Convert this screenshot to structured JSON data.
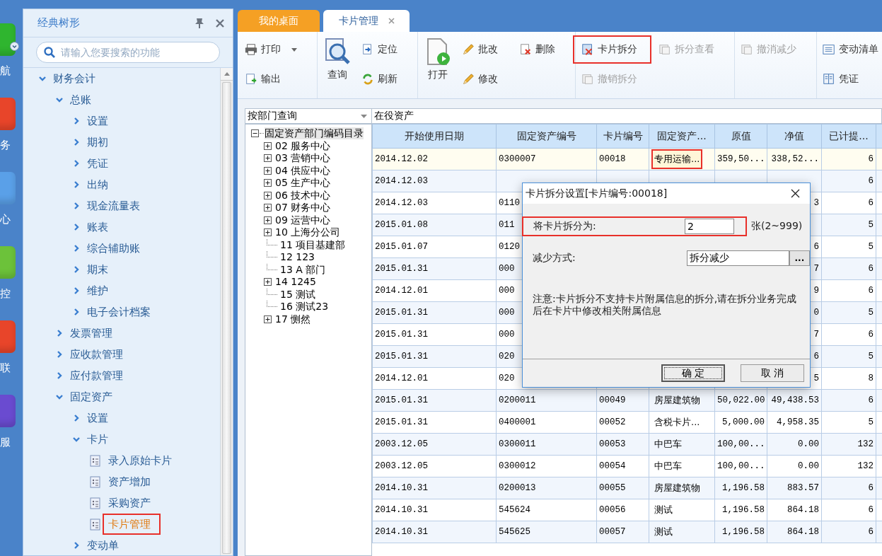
{
  "nav": [
    {
      "label": "航"
    },
    {
      "label": "务"
    },
    {
      "label": "心"
    },
    {
      "label": "控"
    },
    {
      "label": "联"
    },
    {
      "label": "服"
    }
  ],
  "sidebar": {
    "title": "经典树形",
    "search_placeholder": "请输入您要搜索的功能",
    "tree": [
      {
        "label": "财务会计",
        "expanded": true,
        "children": [
          {
            "label": "总账",
            "expanded": true,
            "children": [
              {
                "label": "设置",
                "expanded": false
              },
              {
                "label": "期初",
                "expanded": false
              },
              {
                "label": "凭证",
                "expanded": false
              },
              {
                "label": "出纳",
                "expanded": false
              },
              {
                "label": "现金流量表",
                "expanded": false
              },
              {
                "label": "账表",
                "expanded": false
              },
              {
                "label": "综合辅助账",
                "expanded": false
              },
              {
                "label": "期末",
                "expanded": false
              },
              {
                "label": "维护",
                "expanded": false
              },
              {
                "label": "电子会计档案",
                "expanded": false
              }
            ]
          },
          {
            "label": "发票管理",
            "expanded": false
          },
          {
            "label": "应收款管理",
            "expanded": false
          },
          {
            "label": "应付款管理",
            "expanded": false
          },
          {
            "label": "固定资产",
            "expanded": true,
            "children": [
              {
                "label": "设置",
                "expanded": false
              },
              {
                "label": "卡片",
                "expanded": true,
                "children": [
                  {
                    "label": "录入原始卡片",
                    "kind": "page",
                    "selected": false,
                    "highlighted": false
                  },
                  {
                    "label": "资产增加",
                    "kind": "page",
                    "selected": false,
                    "highlighted": false
                  },
                  {
                    "label": "采购资产",
                    "kind": "page",
                    "selected": false,
                    "highlighted": false
                  },
                  {
                    "label": "卡片管理",
                    "kind": "page",
                    "selected": true,
                    "highlighted": true
                  }
                ]
              },
              {
                "label": "变动单",
                "expanded": false
              }
            ]
          }
        ]
      }
    ]
  },
  "tabs": [
    {
      "label": "我的桌面",
      "selected": false
    },
    {
      "label": "卡片管理",
      "selected": true
    }
  ],
  "toolbar": [
    {
      "buttons": [
        {
          "label": "打印",
          "kind": "menu",
          "disabled": false,
          "highlighted": false
        },
        {
          "label": "输出",
          "kind": "small",
          "disabled": false,
          "highlighted": false
        }
      ]
    },
    {
      "buttons": [
        {
          "label": "查询",
          "kind": "large",
          "disabled": false,
          "highlighted": false
        },
        {
          "label": "定位",
          "kind": "small",
          "disabled": false,
          "highlighted": false
        },
        {
          "label": "刷新",
          "kind": "small",
          "disabled": false,
          "highlighted": false
        }
      ]
    },
    {
      "buttons": [
        {
          "label": "打开",
          "kind": "large",
          "disabled": false,
          "highlighted": false
        },
        {
          "label": "批改",
          "kind": "small",
          "disabled": false,
          "highlighted": false
        },
        {
          "label": "修改",
          "kind": "small",
          "disabled": false,
          "highlighted": false
        },
        {
          "label": "删除",
          "kind": "small",
          "disabled": false,
          "highlighted": false
        }
      ]
    },
    {
      "buttons": [
        {
          "label": "卡片拆分",
          "kind": "small",
          "disabled": false,
          "highlighted": true
        },
        {
          "label": "撤销拆分",
          "kind": "small",
          "disabled": true,
          "highlighted": false
        },
        {
          "label": "拆分查看",
          "kind": "small",
          "disabled": true,
          "highlighted": false
        }
      ]
    },
    {
      "buttons": [
        {
          "label": "撤消减少",
          "kind": "small",
          "disabled": true,
          "highlighted": false
        }
      ]
    },
    {
      "buttons": [
        {
          "label": "变动清单",
          "kind": "small",
          "disabled": false,
          "highlighted": false
        },
        {
          "label": "凭证",
          "kind": "small",
          "disabled": false,
          "highlighted": false
        }
      ]
    }
  ],
  "filter": {
    "query_mode": "按部门查询",
    "status": "在役资产"
  },
  "dept_tree": {
    "label": "固定资产部门编码目录",
    "expanded": true,
    "selected": true,
    "children": [
      {
        "label": "02 服务中心",
        "expandable": true,
        "selected": false
      },
      {
        "label": "03 营销中心",
        "expandable": true,
        "selected": false
      },
      {
        "label": "04 供应中心",
        "expandable": true,
        "selected": false
      },
      {
        "label": "05 生产中心",
        "expandable": true,
        "selected": false
      },
      {
        "label": "06 技术中心",
        "expandable": true,
        "selected": false
      },
      {
        "label": "07 财务中心",
        "expandable": true,
        "selected": false
      },
      {
        "label": "09 运营中心",
        "expandable": true,
        "selected": false
      },
      {
        "label": "10 上海分公司",
        "expandable": true,
        "selected": false
      },
      {
        "label": "11 项目基建部",
        "expandable": false,
        "selected": false
      },
      {
        "label": "12 123",
        "expandable": false,
        "selected": false
      },
      {
        "label": "13 A 部门",
        "expandable": false,
        "selected": false
      },
      {
        "label": "14 1245",
        "expandable": true,
        "selected": false
      },
      {
        "label": "15 测试",
        "expandable": false,
        "selected": false
      },
      {
        "label": "16 测试23",
        "expandable": false,
        "selected": false
      },
      {
        "label": "17 恻然",
        "expandable": true,
        "selected": false
      }
    ]
  },
  "table": {
    "columns": [
      "开始使用日期",
      "固定资产编号",
      "卡片编号",
      "固定资产...",
      "原值",
      "净值",
      "已计提..."
    ],
    "rows": [
      {
        "selected": true,
        "cells": [
          "2014.12.02",
          "0300007",
          "00018",
          "专用运输...",
          "359,50...",
          "338,52...",
          "6"
        ]
      },
      {
        "selected": false,
        "cells": [
          "2014.12.03",
          null,
          null,
          null,
          null,
          null,
          "6"
        ]
      },
      {
        "selected": false,
        "cells": [
          "2014.12.03",
          "0110",
          null,
          null,
          null,
          "3",
          "6"
        ]
      },
      {
        "selected": false,
        "cells": [
          "2015.01.08",
          "011",
          null,
          null,
          null,
          null,
          "5"
        ]
      },
      {
        "selected": false,
        "cells": [
          "2015.01.07",
          "0120",
          null,
          null,
          null,
          "6",
          "5"
        ]
      },
      {
        "selected": false,
        "cells": [
          "2015.01.31",
          "000",
          null,
          null,
          null,
          "7",
          "6"
        ]
      },
      {
        "selected": false,
        "cells": [
          "2014.12.01",
          "000",
          null,
          null,
          null,
          "9",
          "6"
        ]
      },
      {
        "selected": false,
        "cells": [
          "2015.01.31",
          "000",
          null,
          null,
          null,
          "0",
          "5"
        ]
      },
      {
        "selected": false,
        "cells": [
          "2015.01.31",
          "000",
          null,
          null,
          null,
          "7",
          "6"
        ]
      },
      {
        "selected": false,
        "cells": [
          "2015.01.31",
          "020",
          null,
          null,
          null,
          "6",
          "5"
        ]
      },
      {
        "selected": false,
        "cells": [
          "2014.12.01",
          "020",
          null,
          null,
          null,
          "5",
          "8"
        ]
      },
      {
        "selected": false,
        "cells": [
          "2015.01.31",
          "0200011",
          "00049",
          "房屋建筑物",
          "50,022.00",
          "49,438.53",
          "6"
        ]
      },
      {
        "selected": false,
        "cells": [
          "2015.01.31",
          "0400001",
          "00052",
          "含税卡片...",
          "5,000.00",
          "4,958.35",
          "5"
        ]
      },
      {
        "selected": false,
        "cells": [
          "2003.12.05",
          "0300011",
          "00053",
          "中巴车",
          "100,00...",
          "0.00",
          "132"
        ]
      },
      {
        "selected": false,
        "cells": [
          "2003.12.05",
          "0300012",
          "00054",
          "中巴车",
          "100,00...",
          "0.00",
          "132"
        ]
      },
      {
        "selected": false,
        "cells": [
          "2014.10.31",
          "0200013",
          "00055",
          "房屋建筑物",
          "1,196.58",
          "883.57",
          "6"
        ]
      },
      {
        "selected": false,
        "cells": [
          "2014.10.31",
          "545624",
          "00056",
          "测试",
          "1,196.58",
          "864.18",
          "6"
        ]
      },
      {
        "selected": false,
        "cells": [
          "2014.10.31",
          "545625",
          "00057",
          "测试",
          "1,196.58",
          "864.18",
          "6"
        ]
      }
    ]
  },
  "dialog": {
    "title": "卡片拆分设置[卡片编号:00018]",
    "split_label": "将卡片拆分为:",
    "split_value": "2",
    "split_unit": "张(2~999)",
    "split_highlighted": true,
    "reduce_label": "减少方式:",
    "reduce_value": "拆分减少",
    "browse": "...",
    "note": "注意:卡片拆分不支持卡片附属信息的拆分,请在拆分业务完成后在卡片中修改相关附属信息",
    "ok": "确 定",
    "cancel": "取 消"
  }
}
